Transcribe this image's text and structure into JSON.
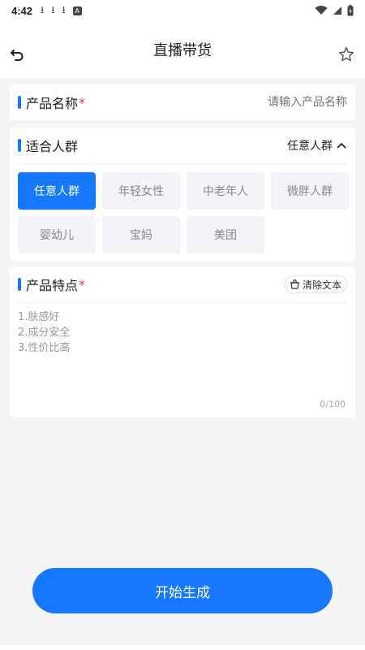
{
  "status_bar": {
    "time": "4:42",
    "icons": [
      "download-icon",
      "download-icon",
      "download-icon",
      "a-icon",
      "wifi-icon",
      "signal-icon",
      "battery-icon"
    ]
  },
  "header": {
    "title": "直播带货",
    "back_icon": "back-icon",
    "favorite_icon": "star-icon"
  },
  "product_name": {
    "label": "产品名称",
    "required": "*",
    "placeholder": "请输入产品名称"
  },
  "audience": {
    "label": "适合人群",
    "selected": "任意人群",
    "options": [
      "任意人群",
      "年轻女性",
      "中老年人",
      "微胖人群",
      "婴幼儿",
      "宝妈",
      "美团"
    ]
  },
  "features": {
    "label": "产品特点",
    "required": "*",
    "clear_label": "清除文本",
    "placeholder": "1.肤感好\n2.成分安全\n3.性价比高",
    "counter": "0/100"
  },
  "start_button": {
    "label": "开始生成"
  },
  "colors": {
    "accent": "#1677ff",
    "required": "#e53935",
    "background": "#f5f5f7"
  }
}
